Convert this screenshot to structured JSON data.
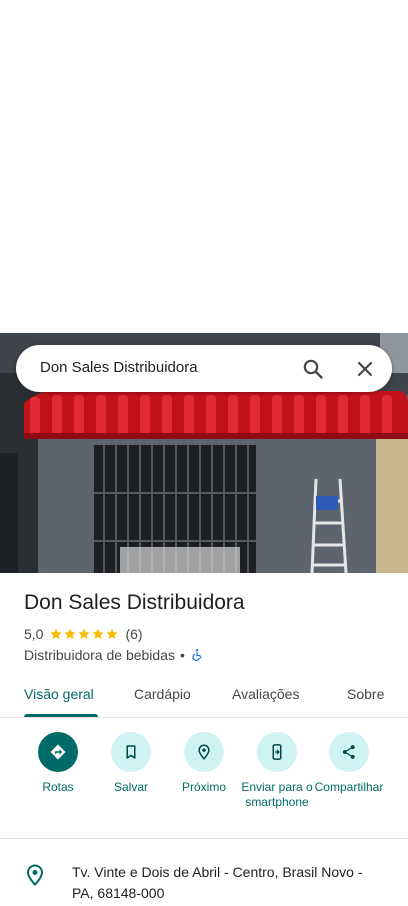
{
  "search": {
    "query": "Don Sales Distribuidora",
    "search_icon": "search-icon",
    "close_icon": "close-icon"
  },
  "photo": {
    "description_icon": "storefront-photo"
  },
  "place": {
    "name": "Don Sales Distribuidora",
    "rating": "5,0",
    "rating_value": 5,
    "stars_max": 5,
    "reviews_count": "(6)",
    "category": "Distribuidora de bebidas",
    "separator": "•",
    "accessibility_icon": "wheelchair-icon"
  },
  "tabs": [
    {
      "label": "Visão geral",
      "active": true
    },
    {
      "label": "Cardápio",
      "active": false
    },
    {
      "label": "Avaliações",
      "active": false
    },
    {
      "label": "Sobre",
      "active": false
    }
  ],
  "actions": [
    {
      "label": "Rotas",
      "icon": "directions-icon"
    },
    {
      "label": "Salvar",
      "icon": "bookmark-icon"
    },
    {
      "label": "Próximo",
      "icon": "nearby-icon"
    },
    {
      "label": "Enviar para o smartphone",
      "icon": "send-to-phone-icon"
    },
    {
      "label": "Compartilhar",
      "icon": "share-icon"
    }
  ],
  "address": {
    "text": "Tv. Vinte e Dois de Abril - Centro, Brasil Novo - PA, 68148-000",
    "icon": "location-pin-icon"
  },
  "colors": {
    "accent": "#006a6a",
    "accent_light": "#cff3f5",
    "star": "#fbbc04",
    "accessibility": "#1a73e8"
  }
}
